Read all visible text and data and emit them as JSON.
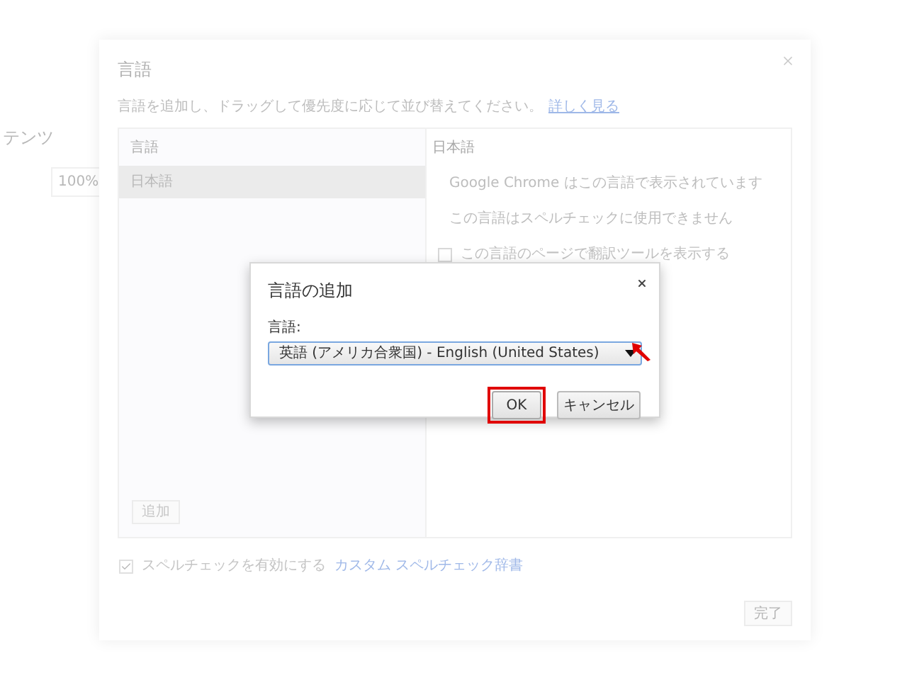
{
  "background_page": {
    "fragments": [
      "テンツ",
      "100%"
    ]
  },
  "dialog": {
    "title": "言語",
    "description": "言語を追加し、ドラッグして優先度に応じて並び替えてください。",
    "learn_more_link": "詳しく見る",
    "language_list": {
      "header": "言語",
      "items": [
        {
          "label": "日本語",
          "selected": true
        }
      ],
      "add_button": "追加"
    },
    "details": {
      "title": "日本語",
      "lines": [
        "Google Chrome はこの言語で表示されています",
        "この言語はスペルチェックに使用できません"
      ],
      "translate_option": {
        "label": "この言語のページで翻訳ツールを表示する",
        "checked": false
      }
    },
    "spellcheck": {
      "label": "スペルチェックを有効にする",
      "checked": true,
      "link": "カスタム スペルチェック辞書"
    },
    "done_button": "完了"
  },
  "add_dialog": {
    "title": "言語の追加",
    "field_label": "言語:",
    "selected_language": "英語 (アメリカ合衆国) - English (United States)",
    "ok_button": "OK",
    "cancel_button": "キャンセル"
  }
}
